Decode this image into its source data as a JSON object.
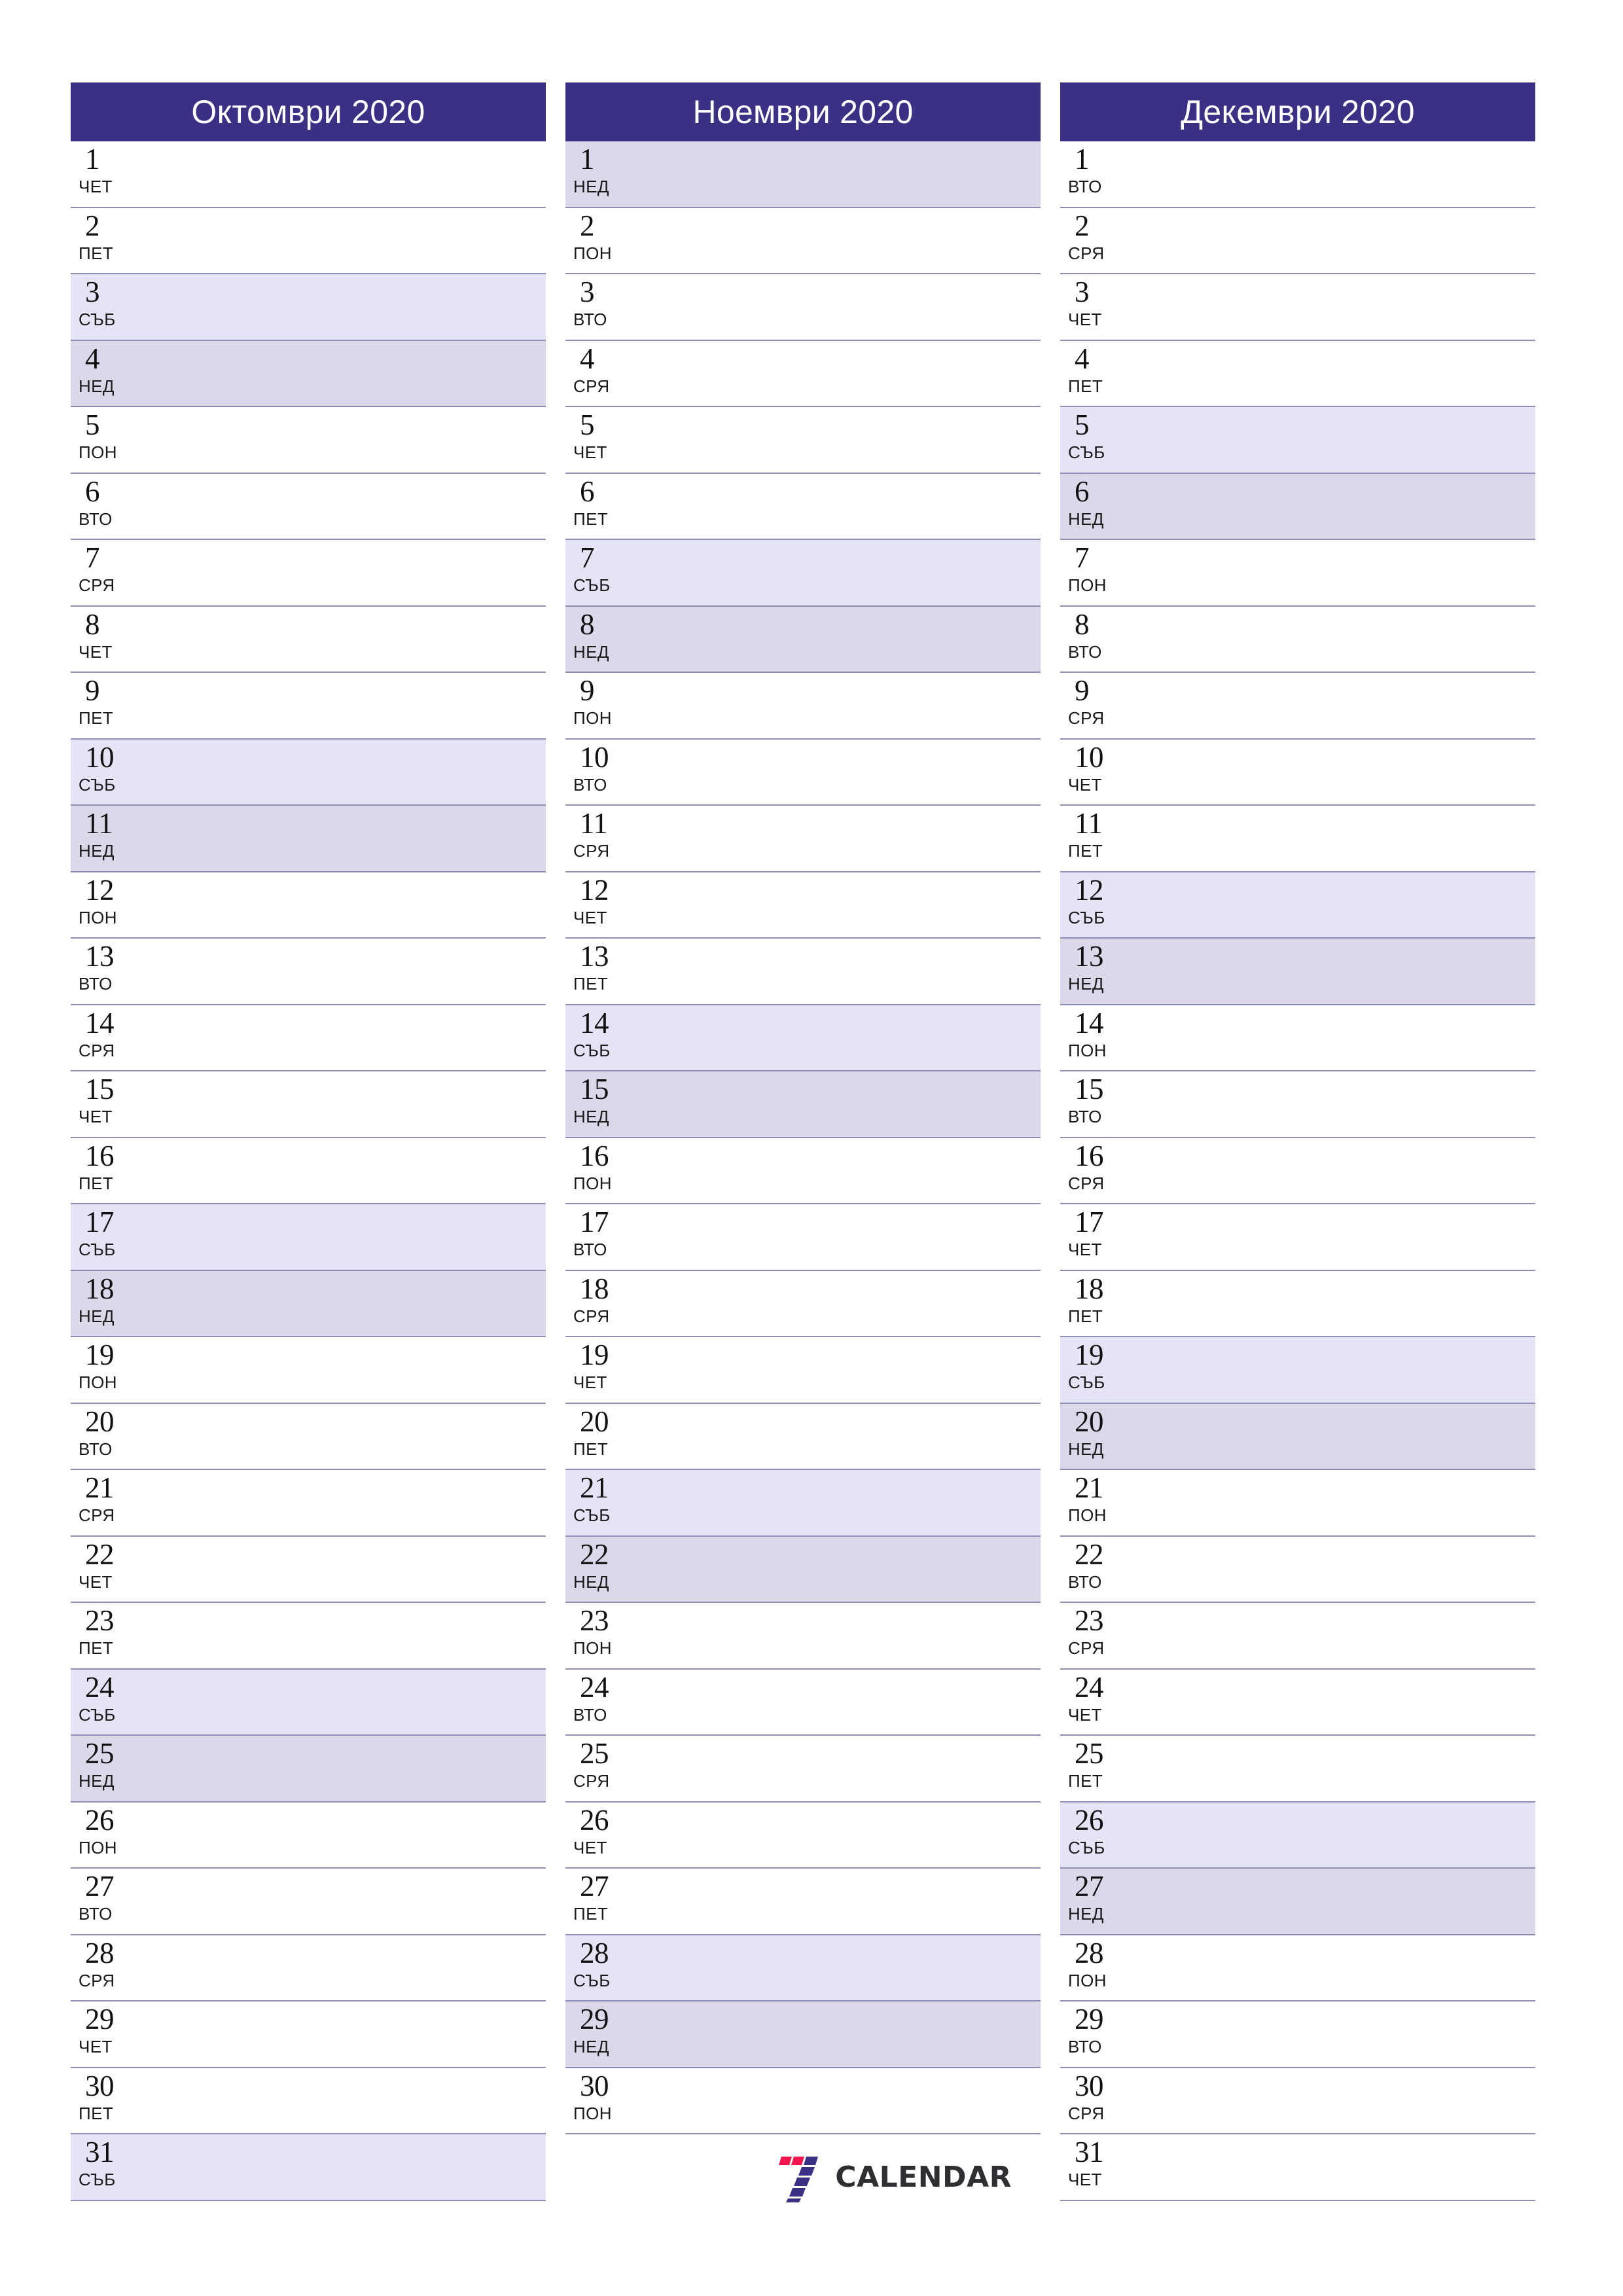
{
  "page": {
    "language": "bg",
    "year": "2020",
    "colors": {
      "header_background": "#3a3185",
      "header_text": "#ffffff",
      "saturday_background": "#e4e4f6",
      "sunday_background": "#dcd8ea",
      "weekday_background": "#ffffff",
      "separator_line": "#8d8db5",
      "day_text": "#111111",
      "logo_red": "#f2164c",
      "logo_purple": "#3a3185",
      "logo_wordmark": "#2e2e33"
    }
  },
  "footer": {
    "logo_icon": "seven-calendar-logo-icon",
    "wordmark": "CALENDAR"
  },
  "months": [
    {
      "title": "Октомври 2020",
      "name": "Октомври",
      "days": [
        {
          "number": "1",
          "weekday": "ЧЕТ",
          "type": "weekday"
        },
        {
          "number": "2",
          "weekday": "ПЕТ",
          "type": "weekday"
        },
        {
          "number": "3",
          "weekday": "СЪБ",
          "type": "saturday"
        },
        {
          "number": "4",
          "weekday": "НЕД",
          "type": "sunday"
        },
        {
          "number": "5",
          "weekday": "ПОН",
          "type": "weekday"
        },
        {
          "number": "6",
          "weekday": "ВТО",
          "type": "weekday"
        },
        {
          "number": "7",
          "weekday": "СРЯ",
          "type": "weekday"
        },
        {
          "number": "8",
          "weekday": "ЧЕТ",
          "type": "weekday"
        },
        {
          "number": "9",
          "weekday": "ПЕТ",
          "type": "weekday"
        },
        {
          "number": "10",
          "weekday": "СЪБ",
          "type": "saturday"
        },
        {
          "number": "11",
          "weekday": "НЕД",
          "type": "sunday"
        },
        {
          "number": "12",
          "weekday": "ПОН",
          "type": "weekday"
        },
        {
          "number": "13",
          "weekday": "ВТО",
          "type": "weekday"
        },
        {
          "number": "14",
          "weekday": "СРЯ",
          "type": "weekday"
        },
        {
          "number": "15",
          "weekday": "ЧЕТ",
          "type": "weekday"
        },
        {
          "number": "16",
          "weekday": "ПЕТ",
          "type": "weekday"
        },
        {
          "number": "17",
          "weekday": "СЪБ",
          "type": "saturday"
        },
        {
          "number": "18",
          "weekday": "НЕД",
          "type": "sunday"
        },
        {
          "number": "19",
          "weekday": "ПОН",
          "type": "weekday"
        },
        {
          "number": "20",
          "weekday": "ВТО",
          "type": "weekday"
        },
        {
          "number": "21",
          "weekday": "СРЯ",
          "type": "weekday"
        },
        {
          "number": "22",
          "weekday": "ЧЕТ",
          "type": "weekday"
        },
        {
          "number": "23",
          "weekday": "ПЕТ",
          "type": "weekday"
        },
        {
          "number": "24",
          "weekday": "СЪБ",
          "type": "saturday"
        },
        {
          "number": "25",
          "weekday": "НЕД",
          "type": "sunday"
        },
        {
          "number": "26",
          "weekday": "ПОН",
          "type": "weekday"
        },
        {
          "number": "27",
          "weekday": "ВТО",
          "type": "weekday"
        },
        {
          "number": "28",
          "weekday": "СРЯ",
          "type": "weekday"
        },
        {
          "number": "29",
          "weekday": "ЧЕТ",
          "type": "weekday"
        },
        {
          "number": "30",
          "weekday": "ПЕТ",
          "type": "weekday"
        },
        {
          "number": "31",
          "weekday": "СЪБ",
          "type": "saturday"
        }
      ]
    },
    {
      "title": "Ноември 2020",
      "name": "Ноември",
      "days": [
        {
          "number": "1",
          "weekday": "НЕД",
          "type": "sunday"
        },
        {
          "number": "2",
          "weekday": "ПОН",
          "type": "weekday"
        },
        {
          "number": "3",
          "weekday": "ВТО",
          "type": "weekday"
        },
        {
          "number": "4",
          "weekday": "СРЯ",
          "type": "weekday"
        },
        {
          "number": "5",
          "weekday": "ЧЕТ",
          "type": "weekday"
        },
        {
          "number": "6",
          "weekday": "ПЕТ",
          "type": "weekday"
        },
        {
          "number": "7",
          "weekday": "СЪБ",
          "type": "saturday"
        },
        {
          "number": "8",
          "weekday": "НЕД",
          "type": "sunday"
        },
        {
          "number": "9",
          "weekday": "ПОН",
          "type": "weekday"
        },
        {
          "number": "10",
          "weekday": "ВТО",
          "type": "weekday"
        },
        {
          "number": "11",
          "weekday": "СРЯ",
          "type": "weekday"
        },
        {
          "number": "12",
          "weekday": "ЧЕТ",
          "type": "weekday"
        },
        {
          "number": "13",
          "weekday": "ПЕТ",
          "type": "weekday"
        },
        {
          "number": "14",
          "weekday": "СЪБ",
          "type": "saturday"
        },
        {
          "number": "15",
          "weekday": "НЕД",
          "type": "sunday"
        },
        {
          "number": "16",
          "weekday": "ПОН",
          "type": "weekday"
        },
        {
          "number": "17",
          "weekday": "ВТО",
          "type": "weekday"
        },
        {
          "number": "18",
          "weekday": "СРЯ",
          "type": "weekday"
        },
        {
          "number": "19",
          "weekday": "ЧЕТ",
          "type": "weekday"
        },
        {
          "number": "20",
          "weekday": "ПЕТ",
          "type": "weekday"
        },
        {
          "number": "21",
          "weekday": "СЪБ",
          "type": "saturday"
        },
        {
          "number": "22",
          "weekday": "НЕД",
          "type": "sunday"
        },
        {
          "number": "23",
          "weekday": "ПОН",
          "type": "weekday"
        },
        {
          "number": "24",
          "weekday": "ВТО",
          "type": "weekday"
        },
        {
          "number": "25",
          "weekday": "СРЯ",
          "type": "weekday"
        },
        {
          "number": "26",
          "weekday": "ЧЕТ",
          "type": "weekday"
        },
        {
          "number": "27",
          "weekday": "ПЕТ",
          "type": "weekday"
        },
        {
          "number": "28",
          "weekday": "СЪБ",
          "type": "saturday"
        },
        {
          "number": "29",
          "weekday": "НЕД",
          "type": "sunday"
        },
        {
          "number": "30",
          "weekday": "ПОН",
          "type": "weekday"
        }
      ]
    },
    {
      "title": "Декември 2020",
      "name": "Декември",
      "days": [
        {
          "number": "1",
          "weekday": "ВТО",
          "type": "weekday"
        },
        {
          "number": "2",
          "weekday": "СРЯ",
          "type": "weekday"
        },
        {
          "number": "3",
          "weekday": "ЧЕТ",
          "type": "weekday"
        },
        {
          "number": "4",
          "weekday": "ПЕТ",
          "type": "weekday"
        },
        {
          "number": "5",
          "weekday": "СЪБ",
          "type": "saturday"
        },
        {
          "number": "6",
          "weekday": "НЕД",
          "type": "sunday"
        },
        {
          "number": "7",
          "weekday": "ПОН",
          "type": "weekday"
        },
        {
          "number": "8",
          "weekday": "ВТО",
          "type": "weekday"
        },
        {
          "number": "9",
          "weekday": "СРЯ",
          "type": "weekday"
        },
        {
          "number": "10",
          "weekday": "ЧЕТ",
          "type": "weekday"
        },
        {
          "number": "11",
          "weekday": "ПЕТ",
          "type": "weekday"
        },
        {
          "number": "12",
          "weekday": "СЪБ",
          "type": "saturday"
        },
        {
          "number": "13",
          "weekday": "НЕД",
          "type": "sunday"
        },
        {
          "number": "14",
          "weekday": "ПОН",
          "type": "weekday"
        },
        {
          "number": "15",
          "weekday": "ВТО",
          "type": "weekday"
        },
        {
          "number": "16",
          "weekday": "СРЯ",
          "type": "weekday"
        },
        {
          "number": "17",
          "weekday": "ЧЕТ",
          "type": "weekday"
        },
        {
          "number": "18",
          "weekday": "ПЕТ",
          "type": "weekday"
        },
        {
          "number": "19",
          "weekday": "СЪБ",
          "type": "saturday"
        },
        {
          "number": "20",
          "weekday": "НЕД",
          "type": "sunday"
        },
        {
          "number": "21",
          "weekday": "ПОН",
          "type": "weekday"
        },
        {
          "number": "22",
          "weekday": "ВТО",
          "type": "weekday"
        },
        {
          "number": "23",
          "weekday": "СРЯ",
          "type": "weekday"
        },
        {
          "number": "24",
          "weekday": "ЧЕТ",
          "type": "weekday"
        },
        {
          "number": "25",
          "weekday": "ПЕТ",
          "type": "weekday"
        },
        {
          "number": "26",
          "weekday": "СЪБ",
          "type": "saturday"
        },
        {
          "number": "27",
          "weekday": "НЕД",
          "type": "sunday"
        },
        {
          "number": "28",
          "weekday": "ПОН",
          "type": "weekday"
        },
        {
          "number": "29",
          "weekday": "ВТО",
          "type": "weekday"
        },
        {
          "number": "30",
          "weekday": "СРЯ",
          "type": "weekday"
        },
        {
          "number": "31",
          "weekday": "ЧЕТ",
          "type": "weekday"
        }
      ]
    }
  ]
}
